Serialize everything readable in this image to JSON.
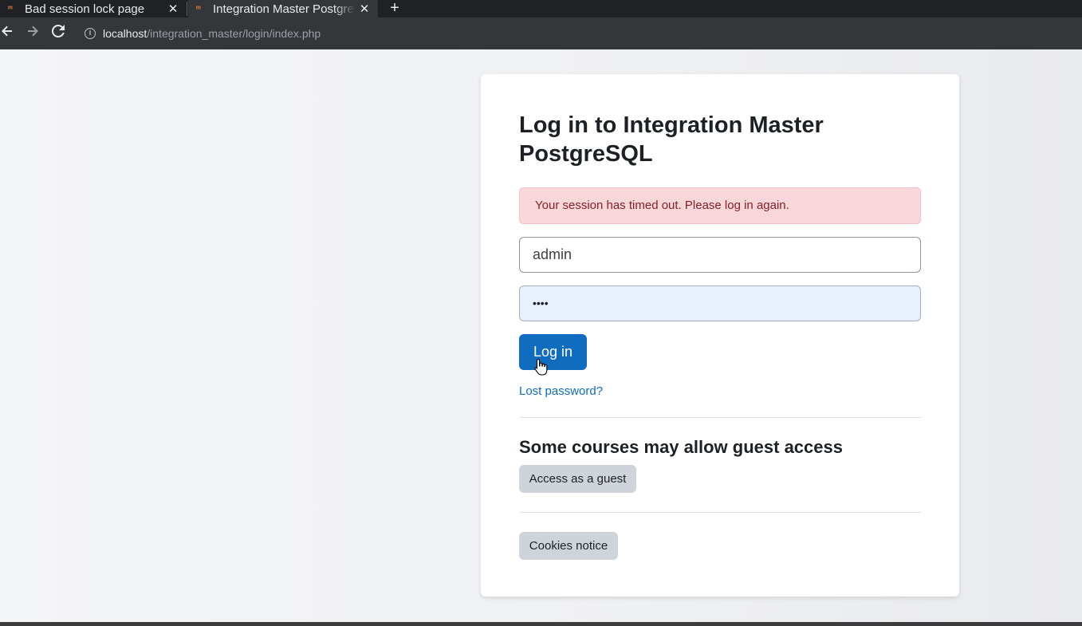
{
  "browser": {
    "tabs": [
      {
        "title": "Bad session lock page",
        "active": false
      },
      {
        "title": "Integration Master PostgreSQL",
        "active": true
      }
    ],
    "new_tab_symbol": "+",
    "close_symbol": "✕",
    "url_host": "localhost",
    "url_path": "/integration_master/login/index.php"
  },
  "login": {
    "title": "Log in to Integration Master PostgreSQL",
    "alert": "Your session has timed out. Please log in again.",
    "username_value": "admin",
    "password_value": "••••",
    "login_button": "Log in",
    "lost_password": "Lost password?",
    "guest_heading": "Some courses may allow guest access",
    "guest_button": "Access as a guest",
    "cookies_button": "Cookies notice"
  },
  "colors": {
    "primary": "#0f6cbf",
    "alert_bg": "#f8d7da",
    "alert_text": "#842029",
    "secondary_btn": "#ced4da"
  },
  "icons": [
    "moodle-favicon",
    "close-icon",
    "plus-icon",
    "back-arrow-icon",
    "forward-arrow-icon",
    "reload-icon",
    "info-icon",
    "hand-cursor-icon"
  ]
}
